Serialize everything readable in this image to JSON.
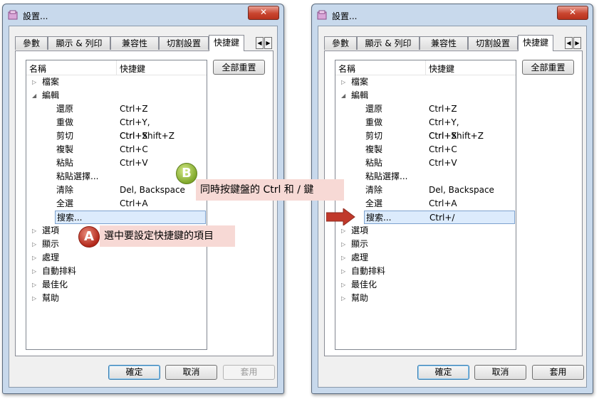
{
  "window": {
    "title": "設置...",
    "close_glyph": "✕"
  },
  "tabs": [
    {
      "label": "參數"
    },
    {
      "label": "顯示 & 列印"
    },
    {
      "label": "兼容性"
    },
    {
      "label": "切割設置"
    },
    {
      "label": "快捷鍵"
    }
  ],
  "tab_arrows": [
    "◀",
    "▶"
  ],
  "list": {
    "col_name": "名稱",
    "col_key": "快捷鍵",
    "tree_left": [
      {
        "name": "檔案",
        "key": "",
        "level": 0,
        "expander": "▷"
      },
      {
        "name": "編輯",
        "key": "",
        "level": 0,
        "expander": "◢"
      },
      {
        "name": "還原",
        "key": "Ctrl+Z",
        "level": 1,
        "expander": ""
      },
      {
        "name": "重做",
        "key": "Ctrl+Y, Ctrl+Shift+Z",
        "level": 1,
        "expander": ""
      },
      {
        "name": "剪切",
        "key": "Ctrl+X",
        "level": 1,
        "expander": ""
      },
      {
        "name": "複製",
        "key": "Ctrl+C",
        "level": 1,
        "expander": ""
      },
      {
        "name": "粘貼",
        "key": "Ctrl+V",
        "level": 1,
        "expander": ""
      },
      {
        "name": "粘貼選擇...",
        "key": "",
        "level": 1,
        "expander": ""
      },
      {
        "name": "清除",
        "key": "Del, Backspace",
        "level": 1,
        "expander": ""
      },
      {
        "name": "全選",
        "key": "Ctrl+A",
        "level": 1,
        "expander": ""
      },
      {
        "name": "搜索...",
        "key": "",
        "level": 1,
        "expander": "",
        "selected": true
      },
      {
        "name": "選項",
        "key": "",
        "level": 0,
        "expander": "▷"
      },
      {
        "name": "顯示",
        "key": "",
        "level": 0,
        "expander": "▷"
      },
      {
        "name": "處理",
        "key": "",
        "level": 0,
        "expander": "▷"
      },
      {
        "name": "自動排料",
        "key": "",
        "level": 0,
        "expander": "▷"
      },
      {
        "name": "最佳化",
        "key": "",
        "level": 0,
        "expander": "▷"
      },
      {
        "name": "幫助",
        "key": "",
        "level": 0,
        "expander": "▷"
      }
    ],
    "tree_right": [
      {
        "name": "檔案",
        "key": "",
        "level": 0,
        "expander": "▷"
      },
      {
        "name": "編輯",
        "key": "",
        "level": 0,
        "expander": "◢"
      },
      {
        "name": "還原",
        "key": "Ctrl+Z",
        "level": 1,
        "expander": ""
      },
      {
        "name": "重做",
        "key": "Ctrl+Y, Ctrl+Shift+Z",
        "level": 1,
        "expander": ""
      },
      {
        "name": "剪切",
        "key": "Ctrl+X",
        "level": 1,
        "expander": ""
      },
      {
        "name": "複製",
        "key": "Ctrl+C",
        "level": 1,
        "expander": ""
      },
      {
        "name": "粘貼",
        "key": "Ctrl+V",
        "level": 1,
        "expander": ""
      },
      {
        "name": "粘貼選擇...",
        "key": "",
        "level": 1,
        "expander": ""
      },
      {
        "name": "清除",
        "key": "Del, Backspace",
        "level": 1,
        "expander": ""
      },
      {
        "name": "全選",
        "key": "Ctrl+A",
        "level": 1,
        "expander": ""
      },
      {
        "name": "搜索...",
        "key": "Ctrl+/",
        "level": 1,
        "expander": "",
        "selected": true
      },
      {
        "name": "選項",
        "key": "",
        "level": 0,
        "expander": "▷"
      },
      {
        "name": "顯示",
        "key": "",
        "level": 0,
        "expander": "▷"
      },
      {
        "name": "處理",
        "key": "",
        "level": 0,
        "expander": "▷"
      },
      {
        "name": "自動排料",
        "key": "",
        "level": 0,
        "expander": "▷"
      },
      {
        "name": "最佳化",
        "key": "",
        "level": 0,
        "expander": "▷"
      },
      {
        "name": "幫助",
        "key": "",
        "level": 0,
        "expander": "▷"
      }
    ]
  },
  "reset_all_label": "全部重置",
  "buttons": {
    "ok": "確定",
    "cancel": "取消",
    "apply": "套用"
  },
  "callouts": {
    "a_badge": "A",
    "a_text": "選中要設定快捷鍵的項目",
    "b_badge": "B",
    "b_text": "同時按鍵盤的 Ctrl 和 / 鍵"
  },
  "colors": {
    "callout_bg": "#f7d9d5",
    "arrow": "#c0392b",
    "selection": "#dcebfc"
  }
}
